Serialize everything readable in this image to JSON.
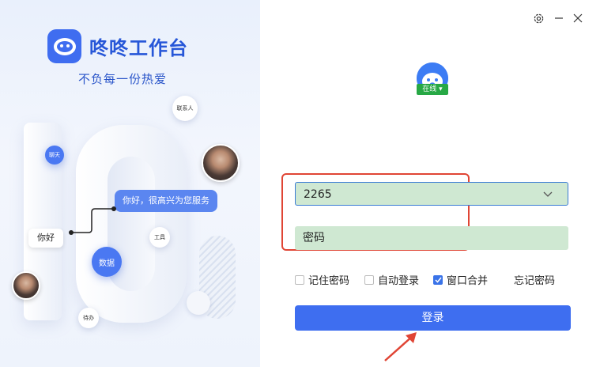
{
  "brand": {
    "name": "咚咚工作台",
    "slogan": "不负每一份热爱"
  },
  "decor": {
    "contacts_chip": "联系人",
    "chat_chip": "聊天",
    "tools_chip": "工具",
    "data_chip": "数据",
    "todo_chip": "待办",
    "greeting_bubble": "你好，很高兴为您服务",
    "hello_tag": "你好"
  },
  "window": {
    "icons": [
      "gear-icon",
      "minimize-icon",
      "close-icon"
    ]
  },
  "user": {
    "status": "在线 ▾"
  },
  "login": {
    "account_value": "2265",
    "password_placeholder": "密码",
    "remember_password": "记住密码",
    "auto_login": "自动登录",
    "merge_windows": "窗口合并",
    "forgot_password": "忘记密码",
    "login_button": "登录"
  },
  "colors": {
    "accent": "#3e6ef0",
    "status_green": "#27a845",
    "field_bg": "#cfe8d2",
    "annotation_red": "#e04535"
  }
}
